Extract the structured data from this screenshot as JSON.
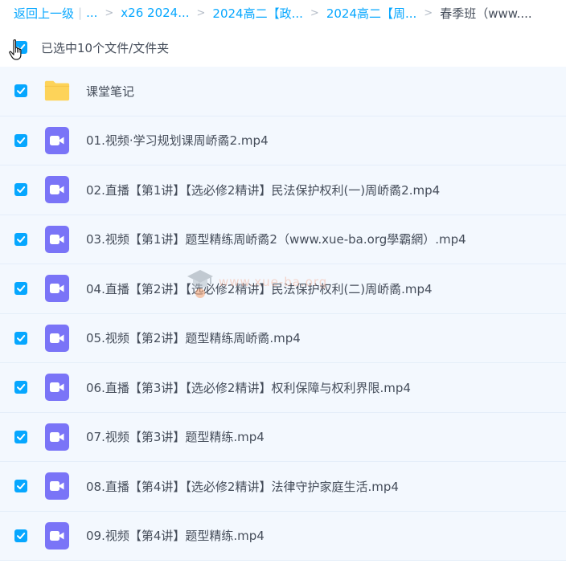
{
  "breadcrumb": {
    "back_label": "返回上一级",
    "separator": "|",
    "ellipsis": "...",
    "items": [
      "x26 2024...",
      "2024高二【政...",
      "2024高二【周..."
    ],
    "current": "春季班（www...."
  },
  "selection": {
    "summary": "已选中10个文件/文件夹"
  },
  "files": [
    {
      "name": "课堂笔记",
      "icon": "folder-icon"
    },
    {
      "name": "01.视频·学习规划课周峤矞2.mp4",
      "icon": "video-file-icon"
    },
    {
      "name": "02.直播【第1讲】【选必修2精讲】民法保护权利(一)周峤矞2.mp4",
      "icon": "video-file-icon"
    },
    {
      "name": "03.视频【第1讲】题型精练周峤矞2（www.xue-ba.org學霸網）.mp4",
      "icon": "video-file-icon"
    },
    {
      "name": "04.直播【第2讲】【选必修2精讲】民法保护权利(二)周峤矞.mp4",
      "icon": "video-file-icon"
    },
    {
      "name": "05.视频【第2讲】题型精练周峤矞.mp4",
      "icon": "video-file-icon"
    },
    {
      "name": "06.直播【第3讲】【选必修2精讲】权利保障与权利界限.mp4",
      "icon": "video-file-icon"
    },
    {
      "name": "07.视频【第3讲】题型精练.mp4",
      "icon": "video-file-icon"
    },
    {
      "name": "08.直播【第4讲】【选必修2精讲】法律守护家庭生活.mp4",
      "icon": "video-file-icon"
    },
    {
      "name": "09.视频【第4讲】题型精练.mp4",
      "icon": "video-file-icon"
    }
  ],
  "watermark": {
    "text": "www.xue-ba.org"
  },
  "colors": {
    "accent": "#06a7ff",
    "row_bg": "#f3f8fe",
    "video_icon": "#7a74f7",
    "folder_icon": "#fdd359",
    "text": "#454d5a"
  }
}
